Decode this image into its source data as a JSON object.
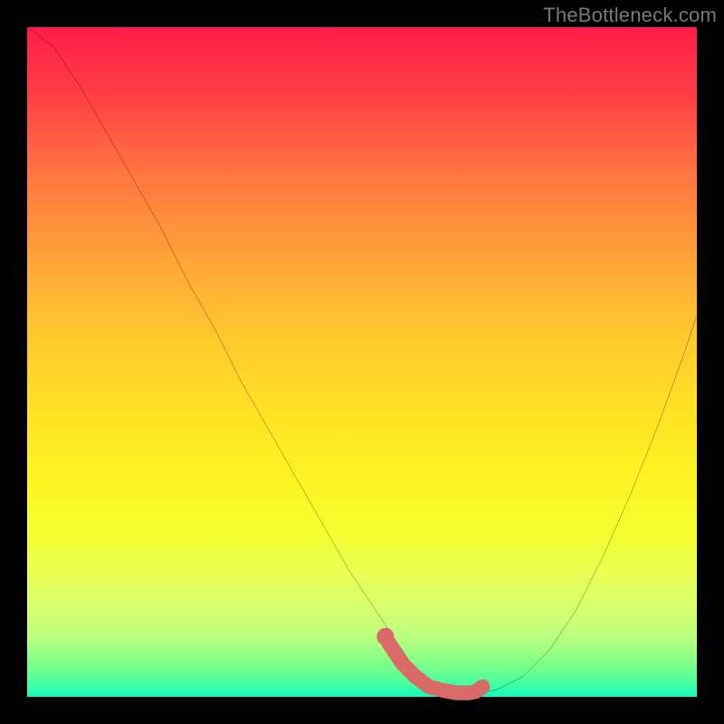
{
  "watermark": "TheBottleneck.com",
  "colors": {
    "page_bg": "#000000",
    "curve": "#000000",
    "highlight": "#d96a68",
    "gradient_top": "#ff1c49",
    "gradient_mid": "#ffe324",
    "gradient_bottom": "#14f6bf"
  },
  "chart_data": {
    "type": "line",
    "title": "",
    "xlabel": "",
    "ylabel": "",
    "xlim": [
      0,
      100
    ],
    "ylim": [
      0,
      100
    ],
    "grid": false,
    "series": [
      {
        "name": "curve",
        "x": [
          0,
          4,
          8,
          12,
          16,
          20,
          24,
          28,
          32,
          36,
          40,
          44,
          48,
          52,
          56,
          58,
          60,
          62,
          64,
          66,
          70,
          74,
          78,
          82,
          86,
          90,
          94,
          98,
          100
        ],
        "y": [
          100,
          97,
          91,
          84,
          77,
          70,
          62,
          55,
          47,
          40,
          33,
          26,
          19,
          13,
          7,
          4,
          2,
          1,
          0.5,
          0.5,
          1,
          3,
          7,
          13,
          21,
          30,
          40,
          51,
          57
        ]
      },
      {
        "name": "highlight-optimal",
        "x": [
          54,
          56,
          58,
          60,
          62,
          64,
          66,
          67,
          68
        ],
        "y": [
          8,
          5,
          3,
          1.5,
          1,
          0.6,
          0.6,
          0.8,
          1.5
        ]
      },
      {
        "name": "highlight-dot",
        "x": [
          53.5
        ],
        "y": [
          9
        ]
      }
    ]
  }
}
